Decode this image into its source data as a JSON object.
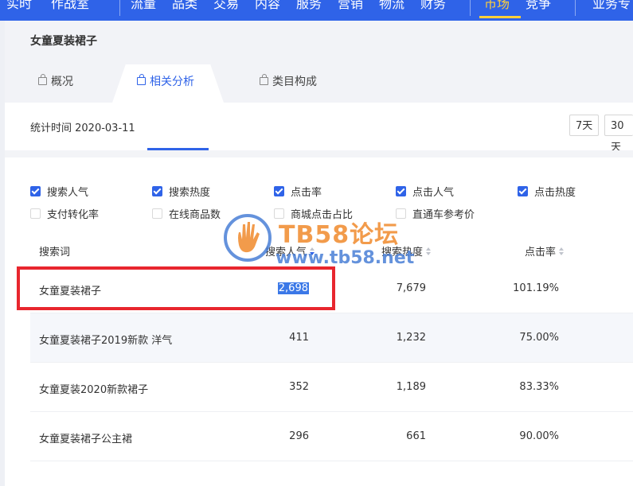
{
  "topnav": {
    "items": [
      "实时",
      "作战室",
      "流量",
      "品类",
      "交易",
      "内容",
      "服务",
      "营销",
      "物流",
      "财务",
      "市场",
      "竞争",
      "业务专"
    ],
    "active": "市场"
  },
  "page": {
    "title": "女童夏装裙子",
    "tabs": [
      {
        "label": "概况",
        "active": false
      },
      {
        "label": "相关分析",
        "active": true
      },
      {
        "label": "类目构成",
        "active": false
      }
    ],
    "stat_time": "统计时间 2020-03-11",
    "ranges": [
      "7天",
      "30天"
    ]
  },
  "metrics": [
    {
      "label": "搜索人气",
      "checked": true
    },
    {
      "label": "搜索热度",
      "checked": true
    },
    {
      "label": "点击率",
      "checked": true
    },
    {
      "label": "点击人气",
      "checked": true
    },
    {
      "label": "点击热度",
      "checked": true
    },
    {
      "label": "支付转化率",
      "checked": false
    },
    {
      "label": "在线商品数",
      "checked": false
    },
    {
      "label": "商城点击占比",
      "checked": false
    },
    {
      "label": "直通车参考价",
      "checked": false
    }
  ],
  "table": {
    "columns": [
      "搜索词",
      "搜索人气",
      "搜索热度",
      "点击率"
    ],
    "rows": [
      {
        "term": "女童夏装裙子",
        "popularity": "2,698",
        "heat": "7,679",
        "ctr": "101.19%"
      },
      {
        "term": "女童夏装裙子2019新款 洋气",
        "popularity": "411",
        "heat": "1,232",
        "ctr": "75.00%"
      },
      {
        "term": "女童夏装2020新款裙子",
        "popularity": "352",
        "heat": "1,189",
        "ctr": "83.33%"
      },
      {
        "term": "女童夏装裙子公主裙",
        "popularity": "296",
        "heat": "661",
        "ctr": "90.00%"
      }
    ]
  },
  "watermark": {
    "title": "TB58论坛",
    "url": "www.tb58.net"
  },
  "colors": {
    "brand": "#2f63e8",
    "highlight_box": "#e8262e",
    "watermark_orange": "#f08a2c"
  }
}
